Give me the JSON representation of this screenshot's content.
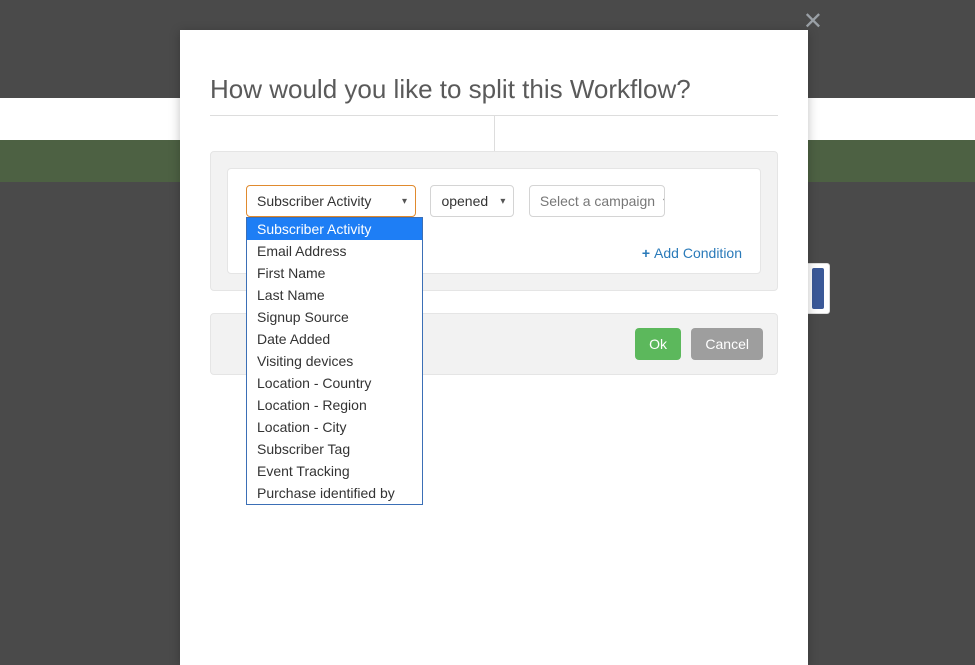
{
  "modal": {
    "title": "How would you like to split this Workflow?",
    "close_label": "Close"
  },
  "conditions": {
    "field_select": {
      "selected": "Subscriber Activity",
      "options": [
        "Subscriber Activity",
        "Email Address",
        "First Name",
        "Last Name",
        "Signup Source",
        "Date Added",
        "Visiting devices",
        "Location - Country",
        "Location - Region",
        "Location - City",
        "Subscriber Tag",
        "Event Tracking",
        "Purchase identified by"
      ]
    },
    "operator_select": {
      "selected": "opened"
    },
    "campaign_select": {
      "placeholder": "Select a campaign"
    },
    "add_condition_label": "Add Condition"
  },
  "actions": {
    "ok": "Ok",
    "cancel": "Cancel"
  }
}
